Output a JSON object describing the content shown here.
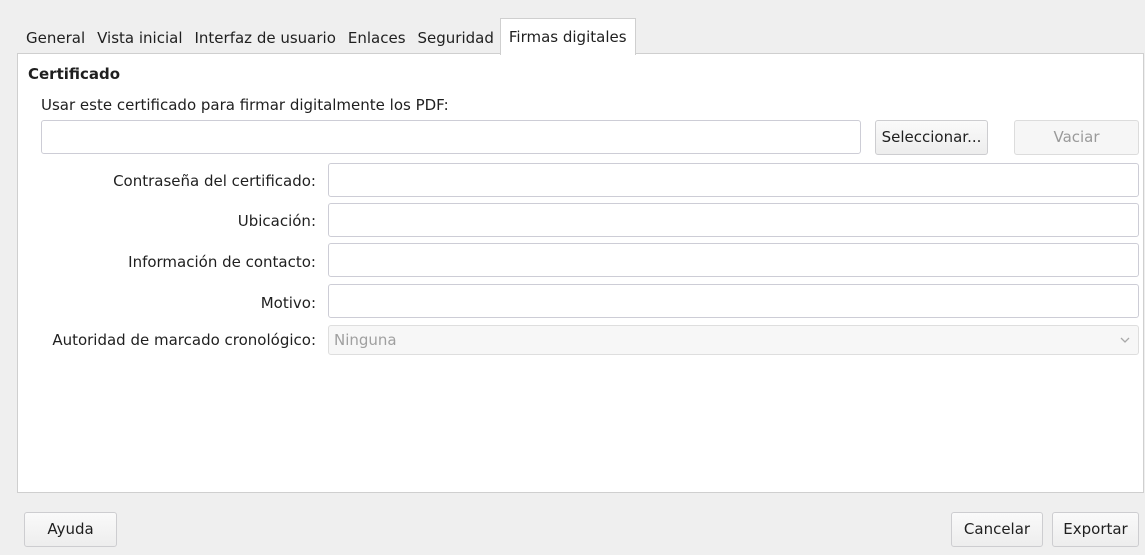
{
  "tabs": [
    {
      "label": "General"
    },
    {
      "label": "Vista inicial"
    },
    {
      "label": "Interfaz de usuario"
    },
    {
      "label": "Enlaces"
    },
    {
      "label": "Seguridad"
    },
    {
      "label": "Firmas digitales",
      "active": true
    }
  ],
  "certificate": {
    "section_title": "Certificado",
    "use_label": "Usar este certificado para firmar digitalmente los PDF:",
    "path_value": "",
    "select_label": "Seleccionar...",
    "clear_label": "Vaciar"
  },
  "fields": {
    "password_label": "Contraseña del certificado:",
    "password_value": "",
    "location_label": "Ubicación:",
    "location_value": "",
    "contact_label": "Información de contacto:",
    "contact_value": "",
    "reason_label": "Motivo:",
    "reason_value": "",
    "tsa_label": "Autoridad de marcado cronológico:",
    "tsa_value": "Ninguna"
  },
  "footer": {
    "help_label": "Ayuda",
    "cancel_label": "Cancelar",
    "export_label": "Exportar"
  },
  "icons": {
    "dropdown": "chevron-down-icon"
  }
}
